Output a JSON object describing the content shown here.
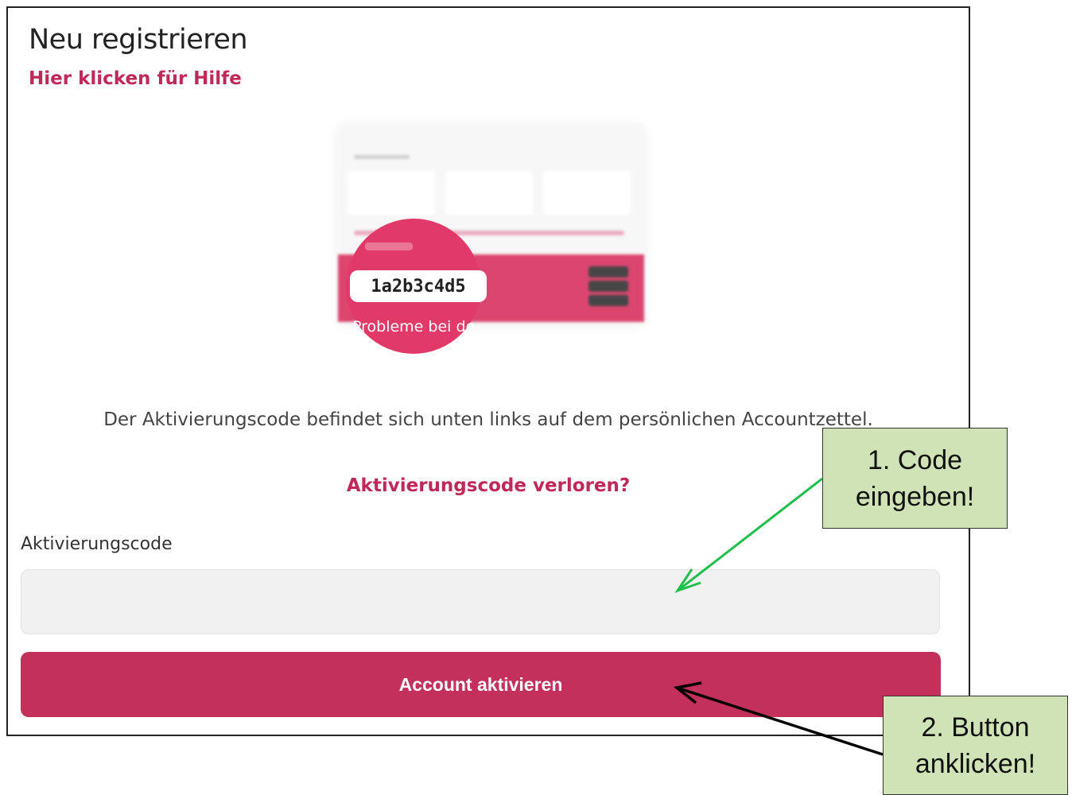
{
  "page": {
    "title": "Neu registrieren",
    "help_link": "Hier klicken für Hilfe"
  },
  "illustration": {
    "code": "1a2b3c4d5",
    "bubble_text": "Probleme bei de"
  },
  "activation": {
    "description": "Der Aktivierungscode befindet sich unten links auf dem persönlichen Accountzettel.",
    "lost_link": "Aktivierungscode verloren?",
    "field_label": "Aktivierungscode",
    "field_value": "",
    "submit_label": "Account aktivieren"
  },
  "annotations": {
    "step1_line1": "1. Code",
    "step1_line2": "eingeben!",
    "step2_line1": "2. Button",
    "step2_line2": "anklicken!"
  },
  "colors": {
    "accent": "#c4305c",
    "link": "#c0285a",
    "callout_fill": "#cfe3b6",
    "arrow_green": "#1fbf4a",
    "arrow_black": "#000000"
  }
}
